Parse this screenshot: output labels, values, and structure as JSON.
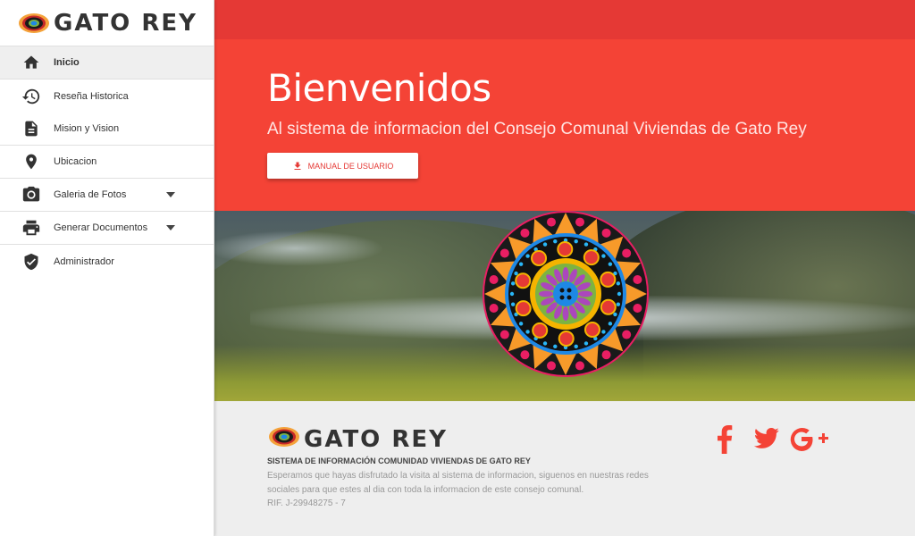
{
  "brand": {
    "name": "GATO REY"
  },
  "sidebar": {
    "items": [
      {
        "label": "Inicio",
        "icon": "home-icon",
        "active": true
      },
      {
        "label": "Reseña Historica",
        "icon": "history-icon"
      },
      {
        "label": "Mision y Vision",
        "icon": "document-icon"
      },
      {
        "label": "Ubicacion",
        "icon": "location-pin-icon"
      },
      {
        "label": "Galeria de Fotos",
        "icon": "camera-icon",
        "has_dropdown": true
      },
      {
        "label": "Generar Documentos",
        "icon": "printer-icon",
        "has_dropdown": true
      },
      {
        "label": "Administrador",
        "icon": "shield-check-icon"
      }
    ]
  },
  "hero": {
    "title": "Bienvenidos",
    "subtitle": "Al sistema de informacion del Consejo Comunal Viviendas de Gato Rey",
    "button_label": "MANUAL DE USUARIO",
    "button_icon": "download-icon"
  },
  "footer": {
    "brand": "GATO REY",
    "title": "SISTEMA DE INFORMACIÓN COMUNIDAD VIVIENDAS DE GATO REY",
    "description": "Esperamos que hayas disfrutado la visita al sistema de informacion, siguenos en nuestras redes sociales para que estes al dia con toda la informacion de este consejo comunal.",
    "rif": "RIF. J-29948275 - 7",
    "social": [
      "facebook-icon",
      "twitter-icon",
      "google-plus-icon"
    ]
  },
  "colors": {
    "primary": "#f44336",
    "primary_dark": "#e53935",
    "sidebar_bg": "#ffffff",
    "footer_bg": "#eeeeee"
  }
}
